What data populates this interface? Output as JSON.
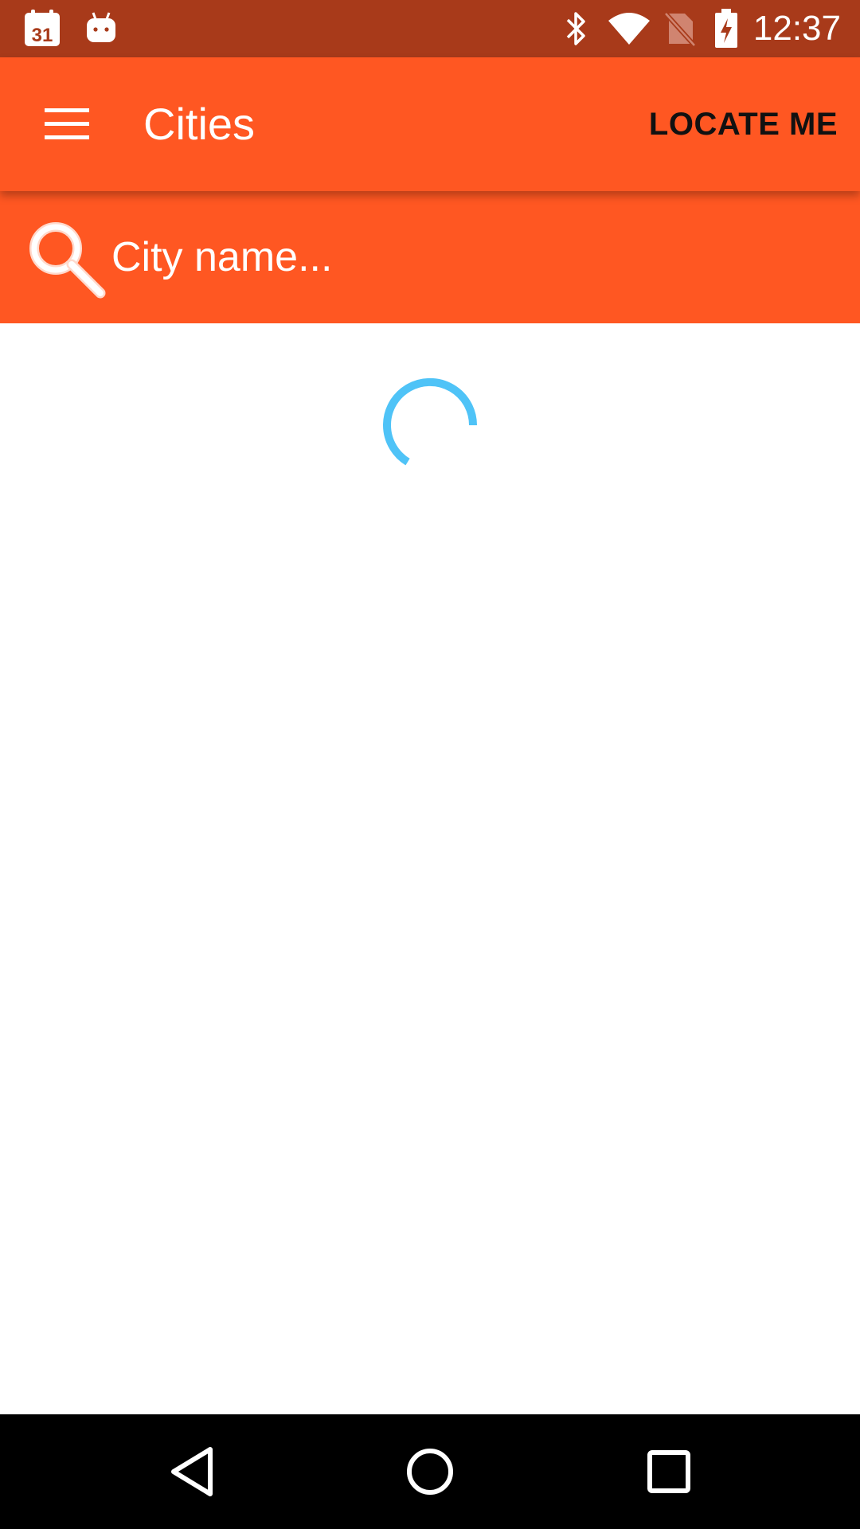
{
  "status_bar": {
    "time": "12:37",
    "calendar_day": "31",
    "background_color": "#A83A1A",
    "icons": [
      "calendar-icon",
      "android-notification-icon",
      "bluetooth-icon",
      "wifi-icon",
      "no-sim-icon",
      "battery-charging-icon"
    ]
  },
  "app_bar": {
    "title": "Cities",
    "locate_label": "LOCATE ME",
    "menu_icon": "hamburger-menu-icon",
    "background_color": "#FF5722"
  },
  "search": {
    "placeholder": "City name...",
    "value": "",
    "icon": "search-icon"
  },
  "content": {
    "loading": true,
    "spinner_color": "#4FC3F7"
  },
  "nav_bar": {
    "icons": [
      "back-icon",
      "home-icon",
      "recents-icon"
    ]
  }
}
